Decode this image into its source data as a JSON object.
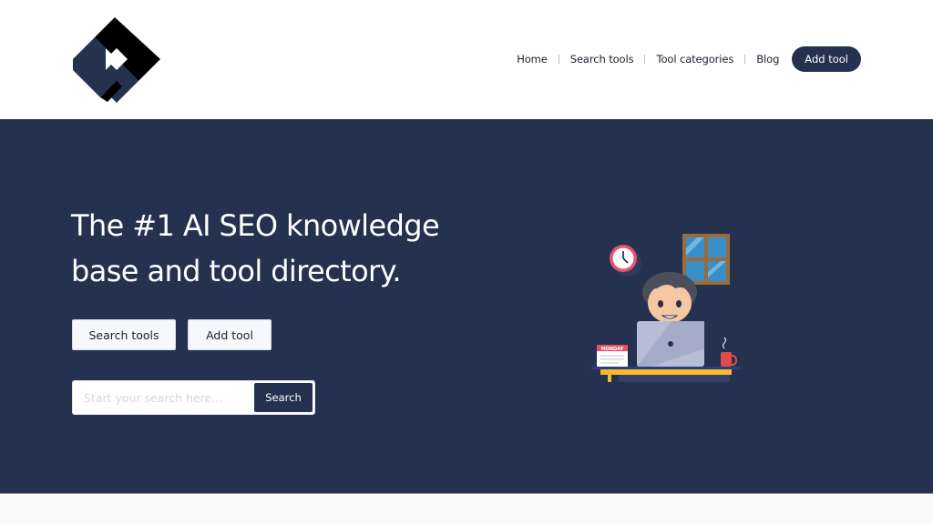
{
  "header": {
    "logo": "brand-logo",
    "nav": [
      {
        "label": "Home"
      },
      {
        "label": "Search tools"
      },
      {
        "label": "Tool categories"
      },
      {
        "label": "Blog"
      }
    ],
    "cta_label": "Add tool"
  },
  "hero": {
    "title_line1": "The #1 AI SEO knowledge",
    "title_line2": "base and tool directory.",
    "buttons": {
      "search_tools": "Search tools",
      "add_tool": "Add tool"
    },
    "search": {
      "placeholder": "Start your search here...",
      "value": "",
      "button_label": "Search"
    },
    "illustration": {
      "name": "person-working-on-laptop",
      "calendar_label": "MONDAY"
    }
  },
  "colors": {
    "brand_navy": "#24324f",
    "header_bg": "#ffffff",
    "page_bg": "#fafafa"
  }
}
